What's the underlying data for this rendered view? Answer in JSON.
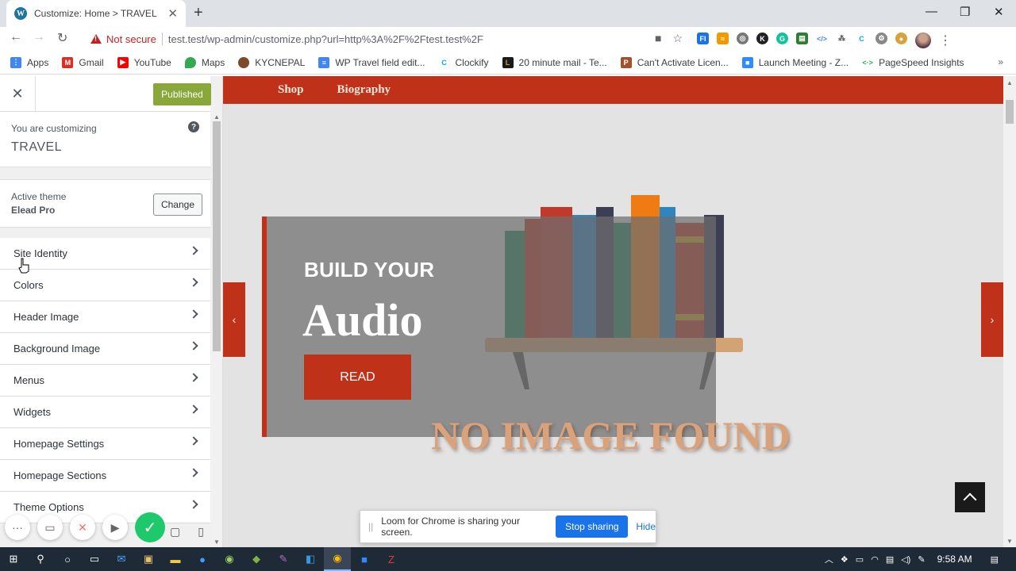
{
  "browser": {
    "tab_title": "Customize: Home > TRAVEL",
    "not_secure": "Not secure",
    "url": "test.test/wp-admin/customize.php?url=http%3A%2F%2Ftest.test%2F"
  },
  "bookmarks": [
    {
      "label": "Apps",
      "icon": "apps-grid-icon",
      "color": "#4285f4"
    },
    {
      "label": "Gmail",
      "icon": "gmail-icon",
      "color": "#d93025"
    },
    {
      "label": "YouTube",
      "icon": "youtube-icon",
      "color": "#ff0000"
    },
    {
      "label": "Maps",
      "icon": "maps-icon",
      "color": "#34a853"
    },
    {
      "label": "KYCNEPAL",
      "icon": "kycnepal-icon",
      "color": "#7a4a2a"
    },
    {
      "label": "WP Travel field edit...",
      "icon": "docs-icon",
      "color": "#4285f4"
    },
    {
      "label": "Clockify",
      "icon": "clockify-icon",
      "color": "#03a9f4"
    },
    {
      "label": "20 minute mail - Te...",
      "icon": "mail-icon",
      "color": "#d4a017"
    },
    {
      "label": "Can't Activate Licen...",
      "icon": "page-icon",
      "color": "#a0522d"
    },
    {
      "label": "Launch Meeting - Z...",
      "icon": "zoom-icon",
      "color": "#2d8cff"
    },
    {
      "label": "PageSpeed Insights",
      "icon": "pagespeed-icon",
      "color": "#34a853"
    }
  ],
  "customizer": {
    "published_label": "Published",
    "customizing_label": "You are customizing",
    "site_name": "TRAVEL",
    "active_theme_label": "Active theme",
    "theme_name": "Elead Pro",
    "change_label": "Change",
    "sections": [
      "Site Identity",
      "Colors",
      "Header Image",
      "Background Image",
      "Menus",
      "Widgets",
      "Homepage Settings",
      "Homepage Sections",
      "Theme Options"
    ]
  },
  "preview": {
    "nav": [
      "Shop",
      "Biography"
    ],
    "slide_subtitle": "BUILD YOUR",
    "slide_title": "Audio",
    "read_button": "READ",
    "no_image_text": "NO IMAGE FOUND",
    "accent_color": "#c0311a"
  },
  "loom": {
    "message": "Loom for Chrome is sharing your screen.",
    "stop_label": "Stop sharing",
    "hide_label": "Hide"
  },
  "taskbar": {
    "time": "9:58 AM"
  }
}
